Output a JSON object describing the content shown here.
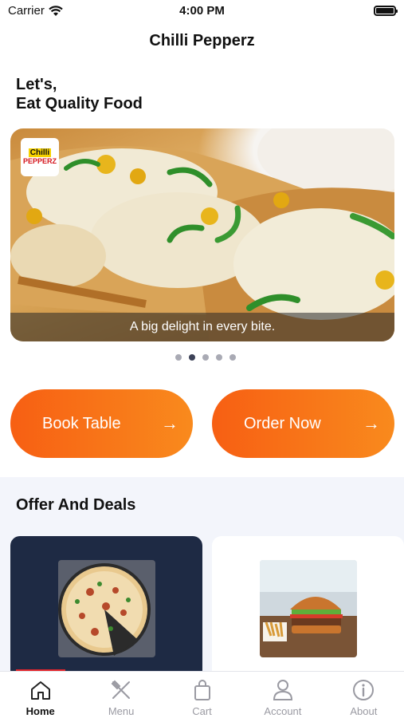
{
  "status_bar": {
    "carrier": "Carrier",
    "time": "4:00 PM"
  },
  "nav": {
    "title": "Chilli Pepperz"
  },
  "greeting": {
    "line1": "Let's,",
    "line2": "Eat Quality Food"
  },
  "banner": {
    "logo_line1": "Chilli",
    "logo_line2": "PEPPERZ",
    "caption": "A big delight in every bite.",
    "page_count": 5,
    "active_page": 2
  },
  "actions": {
    "book_table": "Book Table",
    "order_now": "Order Now"
  },
  "offers": {
    "title": "Offer And Deals"
  },
  "tabs": [
    {
      "label": "Home",
      "icon": "home-icon",
      "active": true
    },
    {
      "label": "Menu",
      "icon": "fork-knife-icon",
      "active": false
    },
    {
      "label": "Cart",
      "icon": "shopping-bag-icon",
      "active": false
    },
    {
      "label": "Account",
      "icon": "person-icon",
      "active": false
    },
    {
      "label": "About",
      "icon": "info-icon",
      "active": false
    }
  ],
  "colors": {
    "accent": "#f75f13",
    "accent_end": "#f98a1d",
    "active_tab_indicator": "#e3262d",
    "dark_card": "#1e2a44"
  }
}
